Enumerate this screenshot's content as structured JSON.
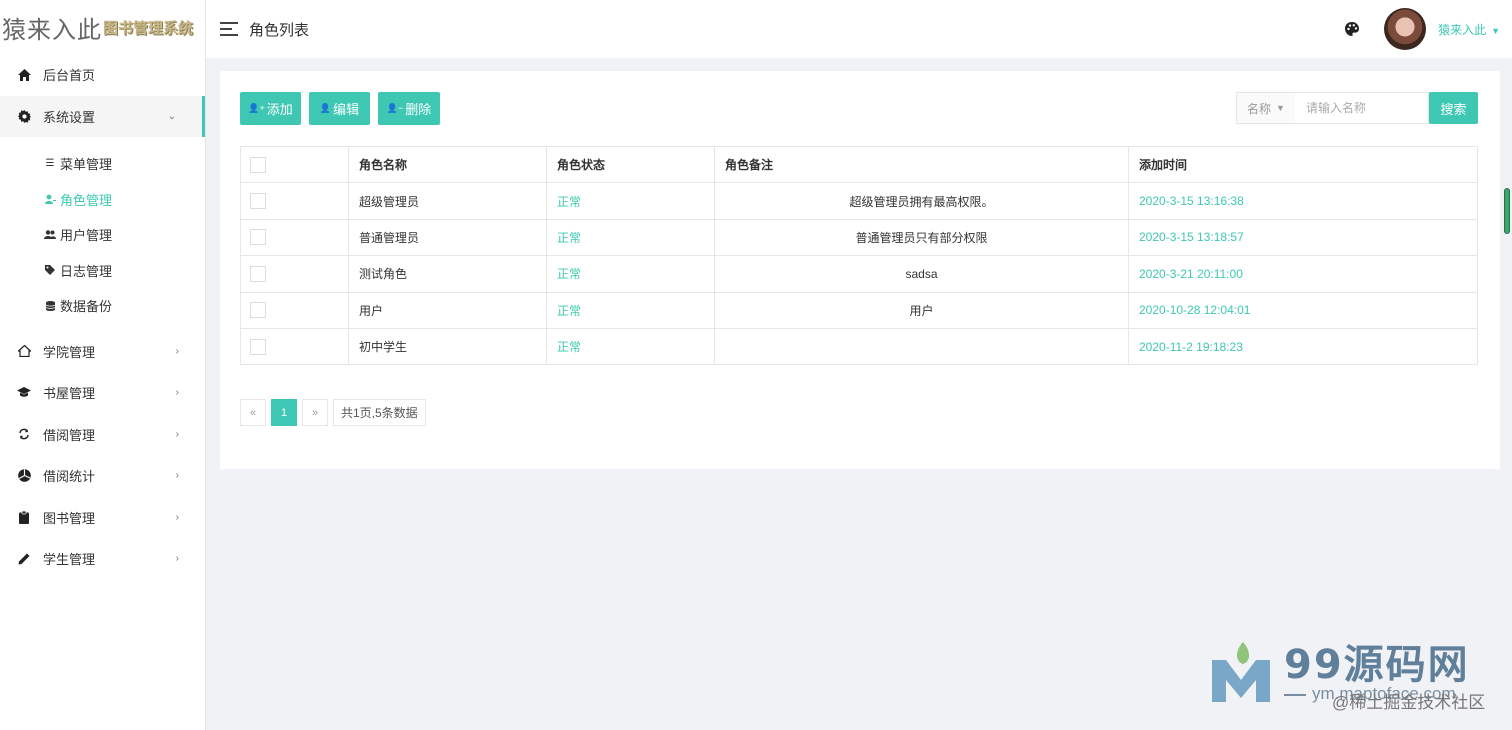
{
  "logo": {
    "main": "猿来入此",
    "sub": "图书管理系统"
  },
  "sidebar": {
    "items": [
      {
        "label": "后台首页",
        "icon": "home-icon"
      },
      {
        "label": "系统设置",
        "icon": "gear-icon",
        "open": true,
        "children": [
          {
            "label": "菜单管理",
            "icon": "list-icon"
          },
          {
            "label": "角色管理",
            "icon": "user-role-icon",
            "active": true
          },
          {
            "label": "用户管理",
            "icon": "users-icon"
          },
          {
            "label": "日志管理",
            "icon": "tag-icon"
          },
          {
            "label": "数据备份",
            "icon": "database-icon"
          }
        ]
      },
      {
        "label": "学院管理",
        "icon": "house-icon"
      },
      {
        "label": "书屋管理",
        "icon": "graduation-cap-icon"
      },
      {
        "label": "借阅管理",
        "icon": "refresh-icon"
      },
      {
        "label": "借阅统计",
        "icon": "chart-icon"
      },
      {
        "label": "图书管理",
        "icon": "clipboard-icon"
      },
      {
        "label": "学生管理",
        "icon": "pencil-icon"
      }
    ]
  },
  "header": {
    "title": "角色列表",
    "username": "猿来入此"
  },
  "toolbar": {
    "add_label": "添加",
    "edit_label": "编辑",
    "delete_label": "删除"
  },
  "search": {
    "field_label": "名称",
    "placeholder": "请输入名称",
    "button_label": "搜索"
  },
  "table": {
    "columns": [
      "角色名称",
      "角色状态",
      "角色备注",
      "添加时间"
    ],
    "rows": [
      {
        "name": "超级管理员",
        "status": "正常",
        "remark": "超级管理员拥有最高权限。",
        "time": "2020-3-15 13:16:38"
      },
      {
        "name": "普通管理员",
        "status": "正常",
        "remark": "普通管理员只有部分权限",
        "time": "2020-3-15 13:18:57"
      },
      {
        "name": "测试角色",
        "status": "正常",
        "remark": "sadsa",
        "time": "2020-3-21 20:11:00"
      },
      {
        "name": "用户",
        "status": "正常",
        "remark": "用户",
        "time": "2020-10-28 12:04:01"
      },
      {
        "name": "初中学生",
        "status": "正常",
        "remark": "",
        "time": "2020-11-2 19:18:23"
      }
    ]
  },
  "pager": {
    "prev": "«",
    "current": "1",
    "next": "»",
    "info": "共1页,5条数据"
  },
  "watermark": {
    "title": "99源码网",
    "url": "ym.maptoface.com",
    "credit": "@稀土掘金技术社区"
  },
  "colors": {
    "accent": "#3ec8b3"
  }
}
